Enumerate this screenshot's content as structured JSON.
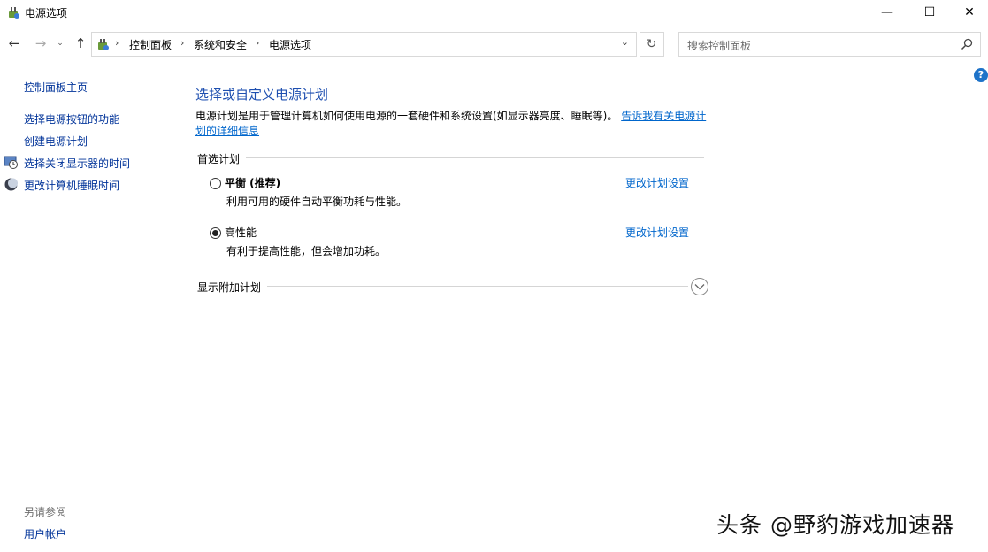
{
  "window": {
    "title": "电源选项",
    "icon": "power-options-icon",
    "minimize_glyph": "—",
    "maximize_glyph": "☐",
    "close_glyph": "✕"
  },
  "nav": {
    "back_glyph": "←",
    "forward_glyph": "→",
    "recent_glyph": "⌄",
    "up_glyph": "↑",
    "refresh_glyph": "↻"
  },
  "address": {
    "crumbs": [
      "控制面板",
      "系统和安全",
      "电源选项"
    ],
    "separator": "›",
    "dropdown_glyph": "⌄"
  },
  "search": {
    "placeholder": "搜索控制面板"
  },
  "help_glyph": "?",
  "left_pane": {
    "home": "控制面板主页",
    "links": [
      "选择电源按钮的功能",
      "创建电源计划",
      "选择关闭显示器的时间",
      "更改计算机睡眠时间"
    ],
    "see_also": "另请参阅",
    "user_accounts": "用户帐户"
  },
  "main": {
    "title": "选择或自定义电源计划",
    "description": "电源计划是用于管理计算机如何使用电源的一套硬件和系统设置(如显示器亮度、睡眠等)。",
    "description_link": "告诉我有关电源计划的详细信息",
    "preferred_label": "首选计划",
    "plans": [
      {
        "name": "平衡 (推荐)",
        "description": "利用可用的硬件自动平衡功耗与性能。",
        "link": "更改计划设置",
        "selected": false
      },
      {
        "name": "高性能",
        "description": "有利于提高性能，但会增加功耗。",
        "link": "更改计划设置",
        "selected": true
      }
    ],
    "additional_label": "显示附加计划"
  },
  "watermark": "头条 @野豹游戏加速器",
  "colors": {
    "link": "#0066cc",
    "title": "#1e4fb0",
    "help": "#1e73c9"
  }
}
